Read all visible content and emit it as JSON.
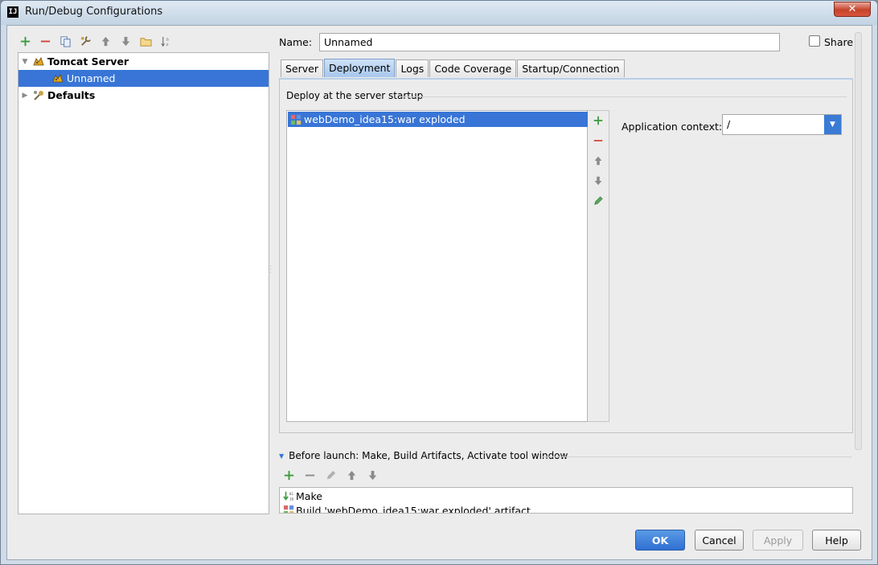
{
  "window": {
    "title": "Run/Debug Configurations",
    "app_icon_text": "IJ",
    "close_glyph": "✕"
  },
  "left_toolbar": {
    "icons": [
      "add-icon",
      "remove-icon",
      "copy-icon",
      "wrench-icon",
      "move-up-icon",
      "move-down-icon",
      "folder-icon",
      "sort-az-icon"
    ]
  },
  "tree": {
    "items": [
      {
        "label": "Tomcat Server",
        "expanded": true,
        "bold": true,
        "icon": "tomcat-icon"
      },
      {
        "label": "Unnamed",
        "selected": true,
        "icon": "tomcat-icon"
      },
      {
        "label": "Defaults",
        "expanded": false,
        "bold": true,
        "icon": "wrench-icon"
      }
    ]
  },
  "name_field": {
    "label": "Name:",
    "value": "Unnamed"
  },
  "share": {
    "label": "Share",
    "checked": false
  },
  "tabs": [
    {
      "label": "Server",
      "active": false
    },
    {
      "label": "Deployment",
      "active": true
    },
    {
      "label": "Logs",
      "active": false
    },
    {
      "label": "Code Coverage",
      "active": false
    },
    {
      "label": "Startup/Connection",
      "active": false
    }
  ],
  "deployment": {
    "section_title": "Deploy at the server startup",
    "items": [
      {
        "label": "webDemo_idea15:war exploded",
        "selected": true,
        "icon": "artifact-icon"
      }
    ],
    "toolbar_icons": [
      "add-icon",
      "remove-icon",
      "move-up-icon",
      "move-down-icon",
      "edit-icon"
    ],
    "app_context_label": "Application context:",
    "app_context_value": "/"
  },
  "before_launch": {
    "title": "Before launch: Make, Build Artifacts, Activate tool window",
    "toolbar_icons": [
      "add-icon",
      "remove-icon",
      "edit-icon",
      "move-up-icon",
      "move-down-icon"
    ],
    "items": [
      {
        "label": "Make",
        "icon": "make-icon"
      },
      {
        "label": "Build 'webDemo_idea15:war exploded' artifact",
        "icon": "artifact-icon"
      }
    ]
  },
  "buttons": {
    "ok": "OK",
    "cancel": "Cancel",
    "apply": "Apply",
    "help": "Help"
  },
  "colors": {
    "selection": "#3875d7",
    "accent_green": "#3a9a3a",
    "accent_red": "#d04437"
  }
}
